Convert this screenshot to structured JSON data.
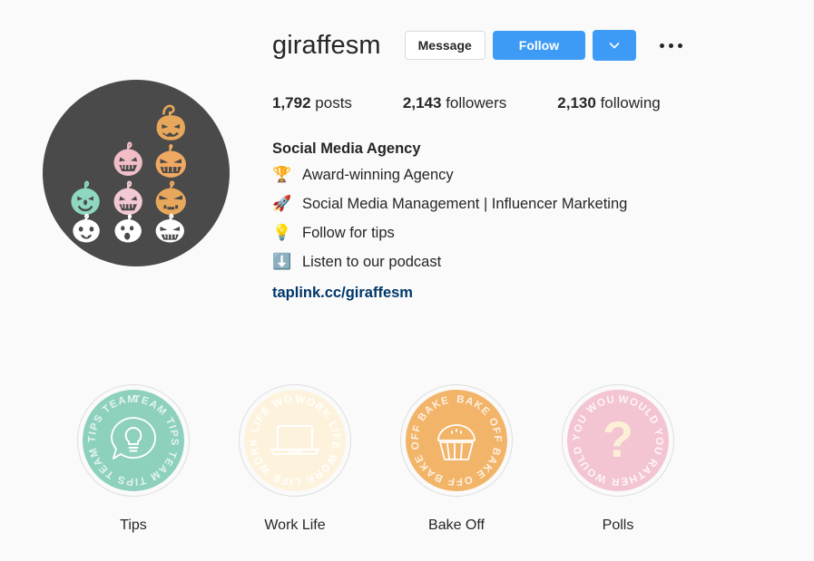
{
  "profile": {
    "username": "giraffesm",
    "avatar": {
      "name": "pumpkin-collage-avatar",
      "background_color": "#4a4a4a",
      "pumpkin_colors": [
        "#e8a85c",
        "#f0bdc8",
        "#f0a962",
        "#8ed7c0",
        "#f3c9d2",
        "#e8a85c",
        "#ffffff",
        "#ffffff",
        "#ffffff"
      ]
    },
    "actions": {
      "message_label": "Message",
      "follow_label": "Follow",
      "chevron_icon": "chevron-down-icon",
      "more_icon": "more-options-icon",
      "follow_color": "#3e9bf5"
    },
    "stats": [
      {
        "number": "1,792",
        "label": "posts"
      },
      {
        "number": "2,143",
        "label": "followers"
      },
      {
        "number": "2,130",
        "label": "following"
      }
    ],
    "bio": {
      "title": "Social Media Agency",
      "lines": [
        {
          "emoji": "🏆",
          "emoji_name": "trophy-icon",
          "text": "Award-winning Agency"
        },
        {
          "emoji": "🚀",
          "emoji_name": "rocket-icon",
          "text": "Social Media Management | Influencer Marketing"
        },
        {
          "emoji": "💡",
          "emoji_name": "lightbulb-icon",
          "text": "Follow for tips"
        },
        {
          "emoji": "⬇️",
          "emoji_name": "down-arrow-icon",
          "text": "Listen to our podcast"
        }
      ],
      "link": "taplink.cc/giraffesm",
      "link_color": "#00376b"
    }
  },
  "highlights": [
    {
      "label": "Tips",
      "cover_color": "#8ed0be",
      "ring_text": "TEAM TIPS TEAM TIPS TEAM TIPS ",
      "icon": "lightbulb-speech-bubble-icon"
    },
    {
      "label": "Work Life",
      "cover_color": "#fdf3dd",
      "ring_text": "WORK LIFE WORK LIFE WORK LIFE ",
      "icon": "laptop-icon"
    },
    {
      "label": "Bake Off",
      "cover_color": "#f2b468",
      "ring_text": "BAKE OFF BAKE OFF BAKE OFF ",
      "icon": "cupcake-icon"
    },
    {
      "label": "Polls",
      "cover_color": "#f3c4d2",
      "ring_text": "WOULD YOU RATHER WOULD YOU ",
      "icon": "question-mark-icon"
    }
  ]
}
